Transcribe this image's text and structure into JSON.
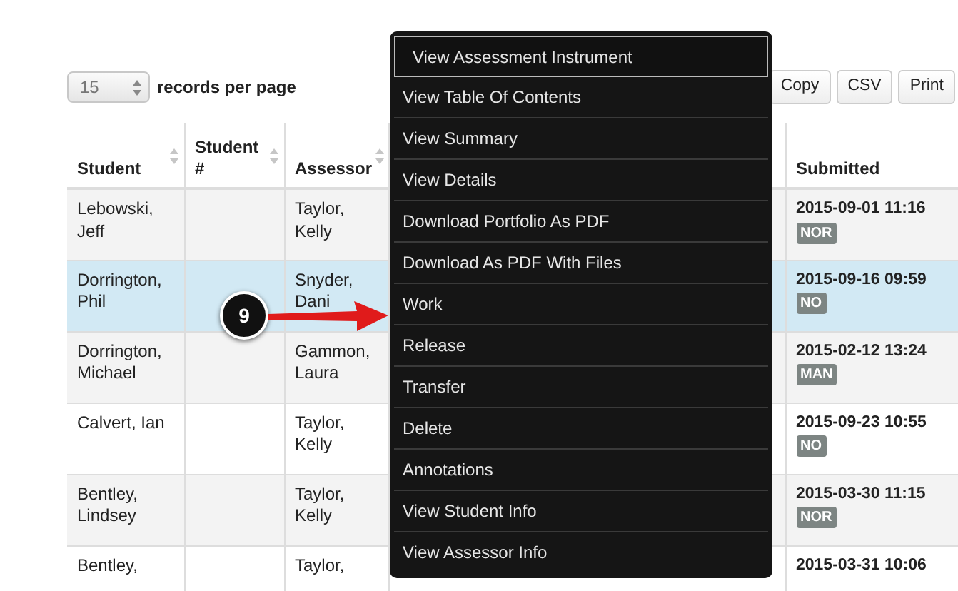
{
  "page_size": {
    "value": "15",
    "label": "records per page"
  },
  "toolbar_buttons": [
    "Copy",
    "CSV",
    "Print"
  ],
  "table": {
    "columns": [
      {
        "label": "Student",
        "sortable": true
      },
      {
        "label": "Student #",
        "sortable": true
      },
      {
        "label": "Assessor",
        "sortable": true
      },
      {
        "label": "Submitted",
        "sortable": false
      }
    ],
    "rows": [
      {
        "selected": false,
        "cells": [
          "Lebowski, Jeff",
          "",
          "Taylor, Kelly",
          "2015-09-01 11:16"
        ],
        "badge": "NOR"
      },
      {
        "selected": true,
        "cells": [
          "Dorrington, Phil",
          "",
          "Snyder, Dani",
          "2015-09-16 09:59"
        ],
        "badge": "NO"
      },
      {
        "selected": false,
        "cells": [
          "Dorrington, Michael",
          "",
          "Gammon, Laura",
          "2015-02-12 13:24"
        ],
        "badge": "MAN"
      },
      {
        "selected": false,
        "cells": [
          "Calvert, Ian",
          "",
          "Taylor, Kelly",
          "2015-09-23 10:55"
        ],
        "badge": "NO"
      },
      {
        "selected": false,
        "cells": [
          "Bentley, Lindsey",
          "",
          "Taylor, Kelly",
          "2015-03-30 11:15"
        ],
        "badge": "NOR"
      },
      {
        "selected": false,
        "cells": [
          "Bentley,",
          "",
          "Taylor,",
          "2015-03-31 10:06"
        ],
        "badge": ""
      }
    ]
  },
  "callout": {
    "number": "9"
  },
  "context_menu": [
    {
      "label": "View Assessment Instrument",
      "selected": true
    },
    {
      "label": "View Table Of Contents",
      "selected": false
    },
    {
      "label": "View Summary",
      "selected": false
    },
    {
      "label": "View Details",
      "selected": false
    },
    {
      "label": "Download Portfolio As PDF",
      "selected": false
    },
    {
      "label": "Download As PDF With Files",
      "selected": false
    },
    {
      "label": "Work",
      "selected": false
    },
    {
      "label": "Release",
      "selected": false
    },
    {
      "label": "Transfer",
      "selected": false
    },
    {
      "label": "Delete",
      "selected": false
    },
    {
      "label": "Annotations",
      "selected": false
    },
    {
      "label": "View Student Info",
      "selected": false
    },
    {
      "label": "View Assessor Info",
      "selected": false
    }
  ]
}
